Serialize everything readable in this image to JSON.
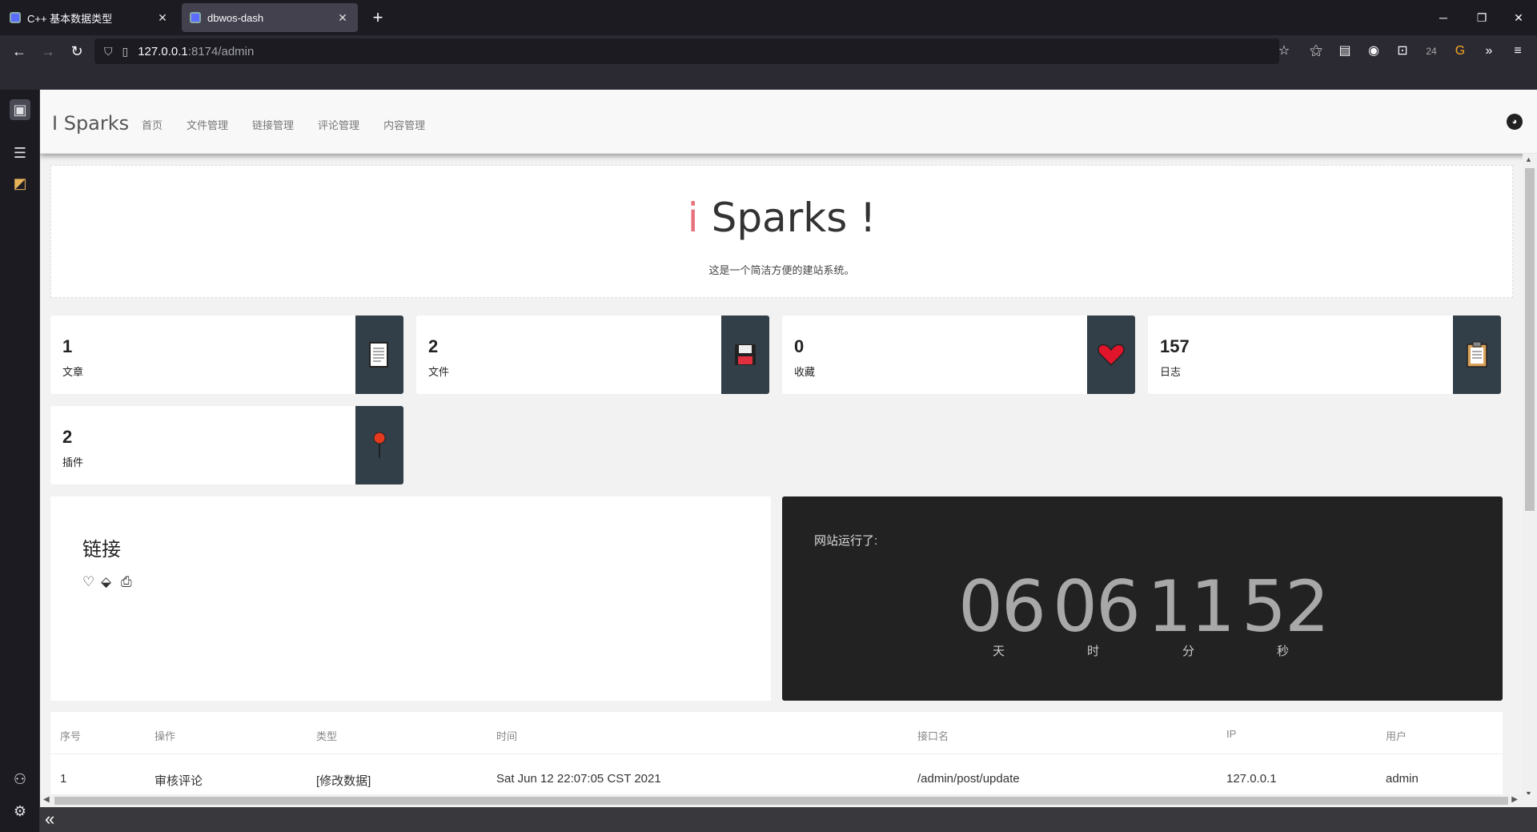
{
  "browser": {
    "tabs": [
      {
        "label": "C++ 基本数据类型",
        "close": "✕"
      },
      {
        "label": "dbwos-dash",
        "close": "✕"
      }
    ],
    "new_tab": "+",
    "url_host": "127.0.0.1",
    "url_rest": ":8174/admin",
    "badge_count": "24"
  },
  "header": {
    "brand": "I Sparks",
    "menu": [
      "首页",
      "文件管理",
      "链接管理",
      "评论管理",
      "内容管理"
    ]
  },
  "hero": {
    "title_i": "i",
    "title_rest": " Sparks !",
    "subtitle": "这是一个简洁方便的建站系统。"
  },
  "stats": [
    {
      "value": "1",
      "label": "文章",
      "icon": "document-icon"
    },
    {
      "value": "2",
      "label": "文件",
      "icon": "floppy-disk-icon"
    },
    {
      "value": "0",
      "label": "收藏",
      "icon": "heart-icon"
    },
    {
      "value": "157",
      "label": "日志",
      "icon": "clipboard-icon"
    },
    {
      "value": "2",
      "label": "插件",
      "icon": "pushpin-icon"
    }
  ],
  "links": {
    "title": "链接",
    "icons": [
      "heart-outline-icon",
      "paint-bucket-icon",
      "camera-icon"
    ]
  },
  "uptime": {
    "title": "网站运行了:",
    "days": "06",
    "hours": "06",
    "minutes": "11",
    "seconds": "52",
    "units": [
      "天",
      "时",
      "分",
      "秒"
    ]
  },
  "log_table": {
    "headers": [
      "序号",
      "操作",
      "类型",
      "时间",
      "接口名",
      "IP",
      "用户"
    ],
    "rows": [
      [
        "1",
        "审核评论",
        "[修改数据]",
        "Sat Jun 12 22:07:05 CST 2021",
        "/admin/post/update",
        "127.0.0.1",
        "admin"
      ]
    ]
  },
  "colors": {
    "accent": "#e7727e",
    "icon_box": "#323f48",
    "timer_bg": "#222222"
  }
}
